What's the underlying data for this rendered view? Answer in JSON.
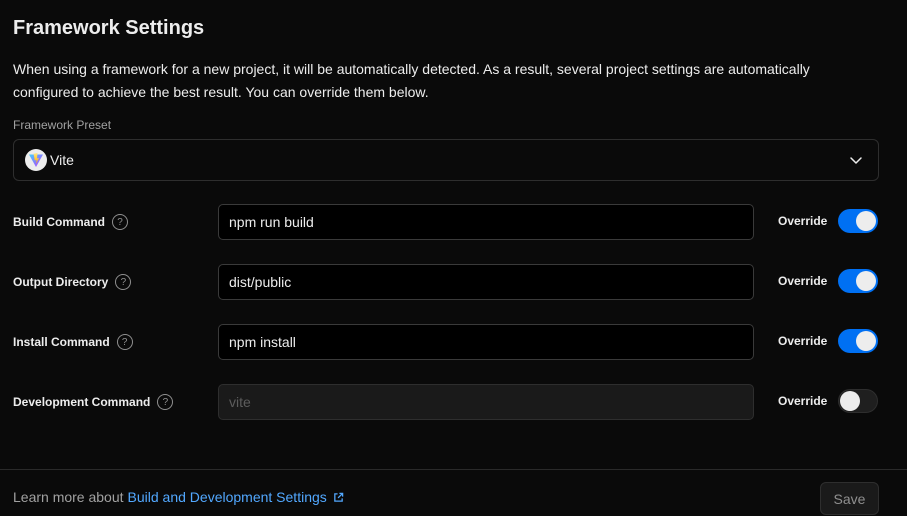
{
  "section": {
    "title": "Framework Settings",
    "description": "When using a framework for a new project, it will be automatically detected. As a result, several project settings are automatically configured to achieve the best result. You can override them below."
  },
  "framework_preset": {
    "label": "Framework Preset",
    "value": "Vite",
    "icon": "vite-logo-icon"
  },
  "settings": [
    {
      "label": "Build Command",
      "value": "npm run build",
      "placeholder": "",
      "override_label": "Override",
      "override": true
    },
    {
      "label": "Output Directory",
      "value": "dist/public",
      "placeholder": "",
      "override_label": "Override",
      "override": true
    },
    {
      "label": "Install Command",
      "value": "npm install",
      "placeholder": "",
      "override_label": "Override",
      "override": true
    },
    {
      "label": "Development Command",
      "value": "",
      "placeholder": "vite",
      "override_label": "Override",
      "override": false
    }
  ],
  "help_glyph": "?",
  "footer": {
    "learn_prefix": "Learn more about",
    "learn_link": "Build and Development Settings",
    "save_label": "Save"
  },
  "colors": {
    "accent": "#0070f3",
    "link": "#52a8ff",
    "background": "#0a0a0a"
  }
}
